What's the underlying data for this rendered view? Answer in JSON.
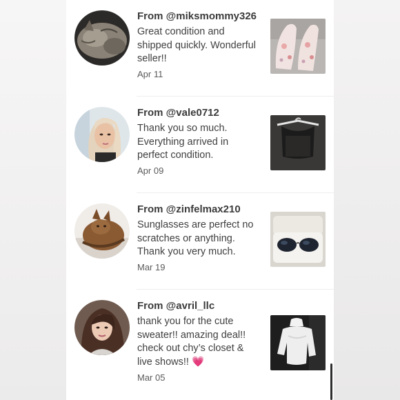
{
  "reviews": [
    {
      "from": "From @miksmommy326",
      "comment": "Great condition and shipped quickly. Wonderful seller!!",
      "date": "Apr 11",
      "avatar_icon": "cat-photo-avatar",
      "thumb_icon": "pink-sneakers-photo"
    },
    {
      "from": "From @vale0712",
      "comment": "Thank you so much. Everything arrived in perfect condition.",
      "date": "Apr 09",
      "avatar_icon": "woman-selfie-avatar",
      "thumb_icon": "black-top-on-hanger-photo"
    },
    {
      "from": "From @zinfelmax210",
      "comment": "Sunglasses are perfect no scratches or anything. Thank you very much.",
      "date": "Mar 19",
      "avatar_icon": "cat-photo-avatar",
      "thumb_icon": "sunglasses-in-case-photo"
    },
    {
      "from": "From @avril_llc",
      "comment": "thank you for the cute sweater!! amazing deal!! check out chy’s closet & live shows!! 💗",
      "date": "Mar 05",
      "avatar_icon": "woman-portrait-avatar",
      "thumb_icon": "white-sweater-photo"
    }
  ]
}
